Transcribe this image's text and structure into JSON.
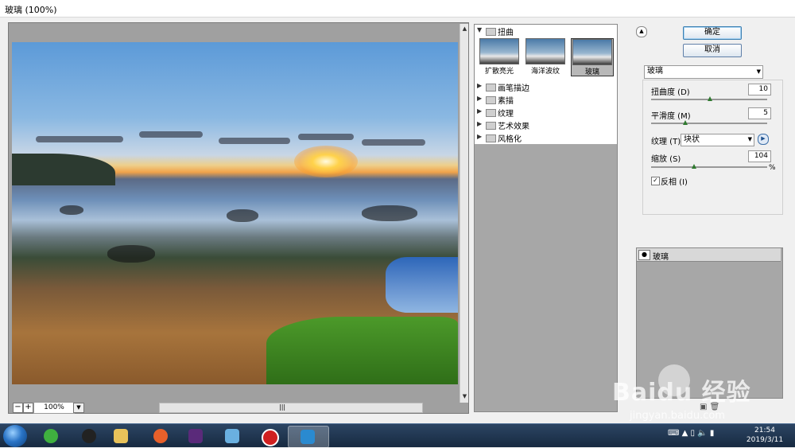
{
  "window": {
    "title": "玻璃 (100%)"
  },
  "preview": {
    "zoom": "100%",
    "zoom_out": "−",
    "zoom_in": "+",
    "scroll_grip": "|||"
  },
  "gallery": {
    "distort": {
      "label": "扭曲",
      "thumbnails": [
        {
          "label": "扩散亮光"
        },
        {
          "label": "海洋波纹"
        },
        {
          "label": "玻璃",
          "selected": true
        }
      ]
    },
    "categories": [
      {
        "label": "画笔描边"
      },
      {
        "label": "素描"
      },
      {
        "label": "纹理"
      },
      {
        "label": "艺术效果"
      },
      {
        "label": "风格化"
      }
    ]
  },
  "buttons": {
    "ok": "确定",
    "cancel": "取消"
  },
  "filter": {
    "selected": "玻璃",
    "distortion": {
      "label": "扭曲度 (D)",
      "value": "10"
    },
    "smoothness": {
      "label": "平滑度 (M)",
      "value": "5"
    },
    "texture": {
      "label": "纹理 (T):",
      "value": "块状"
    },
    "scaling": {
      "label": "缩放 (S)",
      "value": "104",
      "unit": "%"
    },
    "invert": {
      "label": "反相 (I)",
      "checked": true
    }
  },
  "layers": [
    {
      "label": "玻璃",
      "visible": true
    }
  ],
  "taskbar": {
    "time": "21:54",
    "date": "2019/3/11"
  },
  "watermark": {
    "brand": "Baidu 经验",
    "url": "jingyan.baidu.com"
  }
}
